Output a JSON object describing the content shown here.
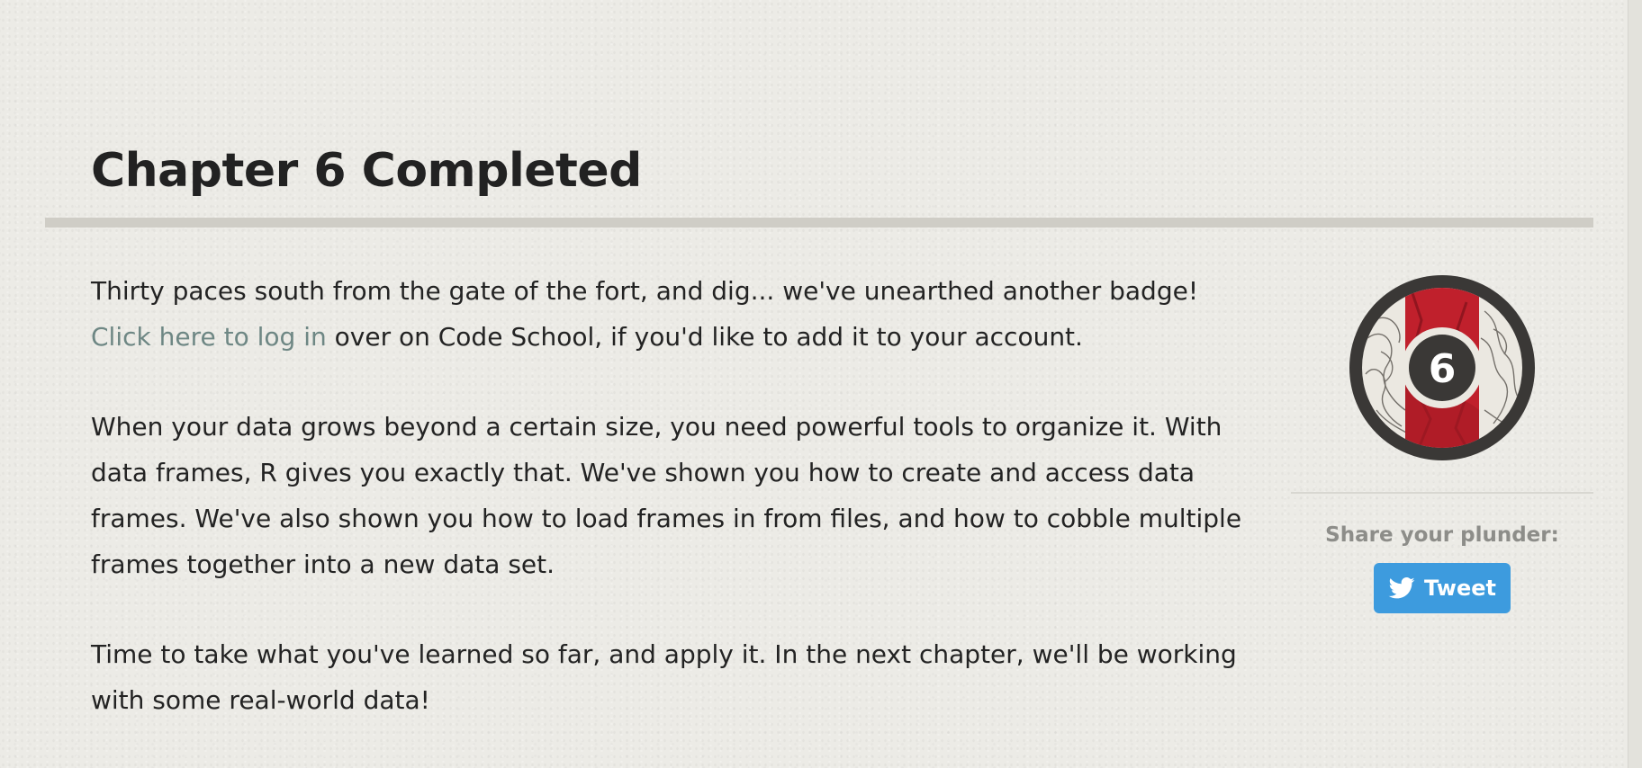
{
  "page": {
    "title": "Chapter 6 Completed"
  },
  "content": {
    "intro_text": "Thirty paces south from the gate of the fort, and dig... we've unearthed another badge!",
    "login_link_label": "Click here to log in",
    "login_suffix": " over on Code School, if you'd like to add it to your account.",
    "paragraph_2": "When your data grows beyond a certain size, you need powerful tools to organize it. With data frames, R gives you exactly that. We've shown you how to create and access data frames. We've also shown you how to load frames in from files, and how to cobble multiple frames together into a new data set.",
    "paragraph_3": "Time to take what you've learned so far, and apply it. In the next chapter, we'll be working with some real-world data!"
  },
  "sidebar": {
    "badge": {
      "number": "6",
      "icon": "chapter-badge-icon"
    },
    "share_label": "Share your plunder:",
    "tweet_label": "Tweet",
    "tweet_icon": "twitter-bird-icon"
  },
  "colors": {
    "link": "#6e8784",
    "badge_red": "#c0202c",
    "badge_dark": "#3a3836",
    "tweet_blue": "#3d9bde"
  }
}
